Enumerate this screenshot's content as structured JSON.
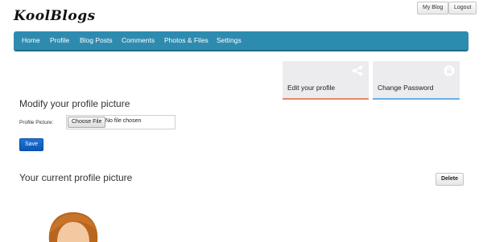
{
  "header": {
    "logo": "KoolBlogs",
    "my_blog_label": "My Blog",
    "logout_label": "Logout"
  },
  "nav": {
    "items": [
      {
        "label": "Home"
      },
      {
        "label": "Profile"
      },
      {
        "label": "Blog Posts"
      },
      {
        "label": "Comments"
      },
      {
        "label": "Photos & Files"
      },
      {
        "label": "Settings"
      }
    ]
  },
  "cards": {
    "edit_profile": {
      "label": "Edit your profile",
      "icon": "share-icon",
      "accent": "#e8866a"
    },
    "change_password": {
      "label": "Change Password",
      "icon": "lock-icon",
      "accent": "#6aaee6"
    }
  },
  "upload": {
    "title": "Modify your profile picture",
    "field_label": "Profile Picture:",
    "choose_file_label": "Choose File",
    "file_status": "No file chosen",
    "save_label": "Save"
  },
  "current": {
    "title": "Your current profile picture",
    "delete_label": "Delete"
  },
  "colors": {
    "nav_bg": "#2e8bb0",
    "primary_button": "#0b56b5",
    "card_bg": "#ececee"
  }
}
